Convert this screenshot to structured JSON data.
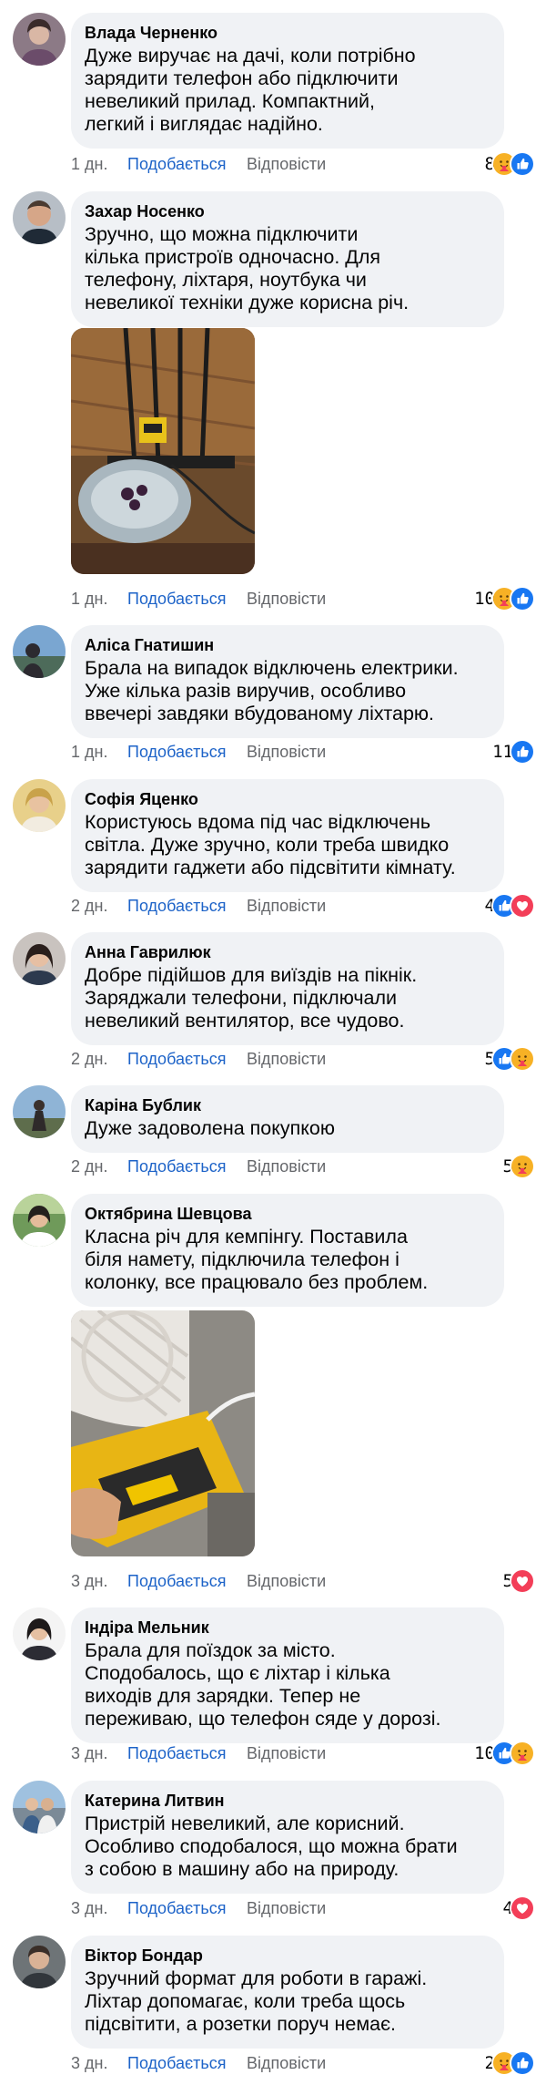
{
  "labels": {
    "like": "Подобається",
    "reply": "Відповісти"
  },
  "comments": [
    {
      "author": "Влада Черненко",
      "text": "Дуже виручає на дачі, коли потрібно\nзарядити телефон або підключити\nневеликий прилад. Компактний,\nлегкий і виглядає надійно.",
      "time": "1 дн.",
      "reactions": {
        "count": "8",
        "icons": [
          "care-reaction-icon",
          "like-reaction-icon"
        ]
      }
    },
    {
      "author": "Захар Носенко",
      "text": "Зручно, що можна підключити\nкілька пристроїв одночасно. Для\nтелефону, ліхтаря, ноутбука чи\nневеликої техніки дуже корисна річ.",
      "time": "1 дн.",
      "photo": "photo-charger-on-floor",
      "reactions": {
        "count": "10",
        "icons": [
          "care-reaction-icon",
          "like-reaction-icon"
        ]
      }
    },
    {
      "author": "Аліса Гнатишин",
      "text": "Брала на випадок відключень електрики.\nУже кілька разів виручив, особливо\nввечері завдяки вбудованому ліхтарю.",
      "time": "1 дн.",
      "reactions": {
        "count": "11",
        "icons": [
          "like-reaction-icon"
        ]
      }
    },
    {
      "author": "Софія Яценко",
      "text": "Користуюсь вдома під час відключень\nсвітла. Дуже зручно, коли треба швидко\nзарядити гаджети або підсвітити кімнату.",
      "time": "2 дн.",
      "reactions": {
        "count": "4",
        "icons": [
          "like-reaction-icon",
          "love-reaction-icon"
        ]
      }
    },
    {
      "author": "Анна Гаврилюк",
      "text": "Добре підійшов для виїздів на пікнік.\nЗаряджали телефони, підключали\nневеликий вентилятор, все чудово.",
      "time": "2 дн.",
      "reactions": {
        "count": "5",
        "icons": [
          "like-reaction-icon",
          "care-reaction-icon"
        ]
      }
    },
    {
      "author": "Каріна Бублик",
      "text": "Дуже задоволена покупкою",
      "time": "2 дн.",
      "reactions": {
        "count": "5",
        "icons": [
          "care-reaction-icon"
        ]
      }
    },
    {
      "author": "Октябрина Шевцова",
      "text": "Класна річ для кемпінгу. Поставила\nбіля намету, підключила телефон і\nколонку, все працювало без проблем.",
      "time": "3 дн.",
      "photo": "photo-charger-with-fan",
      "reactions": {
        "count": "5",
        "icons": [
          "love-reaction-icon"
        ]
      }
    },
    {
      "author": "Індіра Мельник",
      "text": "Брала для поїздок за місто.\nСподобалось, що є ліхтар і кілька\nвиходів для зарядки. Тепер не\nпереживаю, що телефон сяде у дорозі.",
      "time": "3 дн.",
      "reactions": {
        "count": "10",
        "icons": [
          "like-reaction-icon",
          "care-reaction-icon"
        ]
      }
    },
    {
      "author": "Катерина Литвин",
      "text": "Пристрій невеликий, але корисний.\nОсобливо сподобалося, що можна брати\nз собою в машину або на природу.",
      "time": "3 дн.",
      "reactions": {
        "count": "4",
        "icons": [
          "love-reaction-icon"
        ]
      }
    },
    {
      "author": "Віктор Бондар",
      "text": "Зручний формат для роботи в гаражі.\nЛіхтар допомагає, коли треба щось\nпідсвітити, а розетки поруч немає.",
      "time": "3 дн.",
      "reactions": {
        "count": "2",
        "icons": [
          "care-reaction-icon",
          "like-reaction-icon"
        ]
      }
    }
  ],
  "colors": {
    "bubble": "#f0f2f5",
    "like_link": "#1d63c8",
    "meta": "#65676b",
    "like_reaction": "#1877f2",
    "love_reaction": "#f33e58",
    "care_reaction": "#f7b125"
  }
}
